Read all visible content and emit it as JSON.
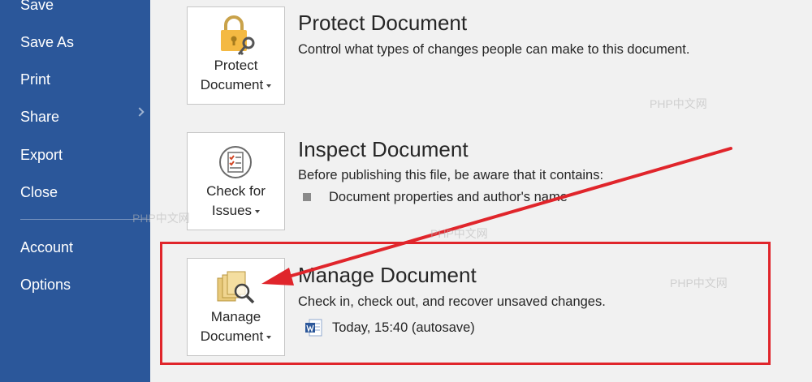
{
  "sidebar": {
    "items": [
      {
        "id": "save",
        "label": "Save"
      },
      {
        "id": "save-as",
        "label": "Save As"
      },
      {
        "id": "print",
        "label": "Print"
      },
      {
        "id": "share",
        "label": "Share"
      },
      {
        "id": "export",
        "label": "Export"
      },
      {
        "id": "close",
        "label": "Close"
      },
      {
        "id": "account",
        "label": "Account"
      },
      {
        "id": "options",
        "label": "Options"
      }
    ]
  },
  "protect": {
    "button_line1": "Protect",
    "button_line2": "Document",
    "title": "Protect Document",
    "description": "Control what types of changes people can make to this document.",
    "icon": "lock-key-icon"
  },
  "inspect": {
    "button_line1": "Check for",
    "button_line2": "Issues",
    "title": "Inspect Document",
    "description": "Before publishing this file, be aware that it contains:",
    "bullet": "Document properties and author's name",
    "icon": "checklist-icon"
  },
  "manage": {
    "button_line1": "Manage",
    "button_line2": "Document",
    "title": "Manage Document",
    "description": "Check in, check out, and recover unsaved changes.",
    "version": "Today, 15:40 (autosave)",
    "icon": "folder-search-icon"
  },
  "annotation": {
    "color": "#e0252b"
  },
  "watermark": {
    "text": "PHP中文网"
  },
  "colors": {
    "sidebar": "#2b579a",
    "background": "#f1f1f1",
    "accent_gold": "#f4b942"
  }
}
